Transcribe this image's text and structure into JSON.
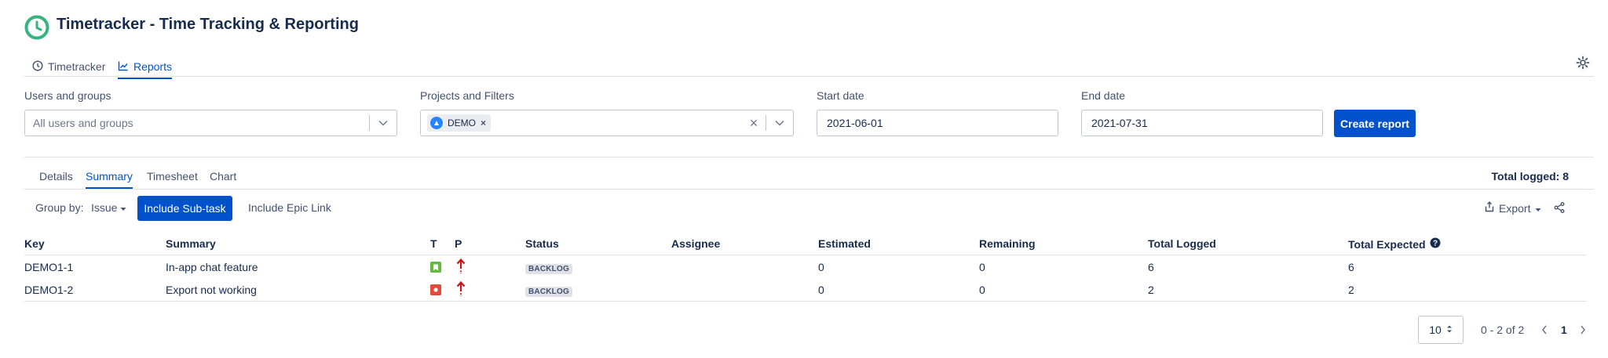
{
  "app": {
    "title": "Timetracker - Time Tracking & Reporting",
    "logo_color": "#36b37e"
  },
  "nav": {
    "tabs": [
      {
        "label": "Timetracker"
      },
      {
        "label": "Reports"
      }
    ]
  },
  "filters": {
    "users_label": "Users and groups",
    "users_placeholder": "All users and groups",
    "projects_label": "Projects and Filters",
    "project_chip": "DEMO",
    "start_label": "Start date",
    "start_value": "2021-06-01",
    "end_label": "End date",
    "end_value": "2021-07-31",
    "create_button": "Create report"
  },
  "subtabs": [
    "Details",
    "Summary",
    "Timesheet",
    "Chart"
  ],
  "total_logged": "Total logged: 8",
  "toolbar": {
    "group_by_label": "Group by:",
    "group_by_value": "Issue",
    "include_subtask": "Include Sub-task",
    "include_epic": "Include Epic Link",
    "export": "Export"
  },
  "table": {
    "headers": {
      "key": "Key",
      "summary": "Summary",
      "t": "T",
      "p": "P",
      "status": "Status",
      "assignee": "Assignee",
      "estimated": "Estimated",
      "remaining": "Remaining",
      "total_logged": "Total Logged",
      "total_expected": "Total Expected"
    },
    "rows": [
      {
        "key": "DEMO1-1",
        "summary": "In-app chat feature",
        "type": "story-icon",
        "priority": "highest-priority-icon",
        "status": "BACKLOG",
        "assignee": "",
        "estimated": "0",
        "remaining": "0",
        "total_logged": "6",
        "total_expected": "6"
      },
      {
        "key": "DEMO1-2",
        "summary": "Export not working",
        "type": "bug-icon",
        "priority": "highest-priority-icon",
        "status": "BACKLOG",
        "assignee": "",
        "estimated": "0",
        "remaining": "0",
        "total_logged": "2",
        "total_expected": "2"
      }
    ]
  },
  "pagination": {
    "page_size": "10",
    "range": "0 - 2 of 2",
    "current_page": "1"
  },
  "colors": {
    "accent": "#0052cc",
    "story": "#63ba3c",
    "bug": "#e5493a",
    "priority": "#cd1317"
  }
}
